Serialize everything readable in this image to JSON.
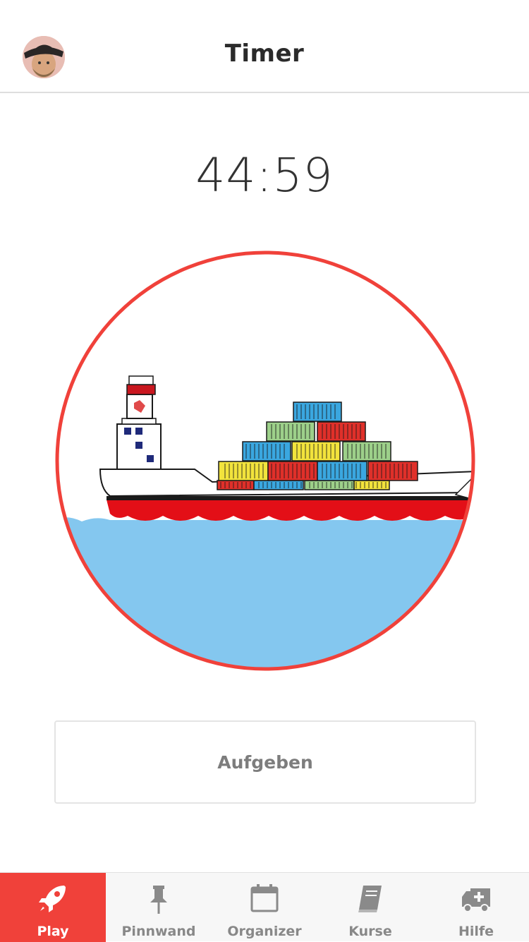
{
  "header": {
    "title": "Timer",
    "avatar_icon": "user-avatar"
  },
  "timer": {
    "remaining": "44:59"
  },
  "illustration": {
    "subject": "container-ship-icon",
    "ring_color": "#f0413a",
    "water_color": "#84c7ef"
  },
  "actions": {
    "give_up_label": "Aufgeben"
  },
  "tabbar": {
    "active_color": "#f0413a",
    "items": [
      {
        "label": "Play",
        "icon": "rocket-icon",
        "active": true
      },
      {
        "label": "Pinnwand",
        "icon": "pushpin-icon",
        "active": false
      },
      {
        "label": "Organizer",
        "icon": "calendar-icon",
        "active": false
      },
      {
        "label": "Kurse",
        "icon": "book-icon",
        "active": false
      },
      {
        "label": "Hilfe",
        "icon": "ambulance-icon",
        "active": false
      }
    ]
  }
}
